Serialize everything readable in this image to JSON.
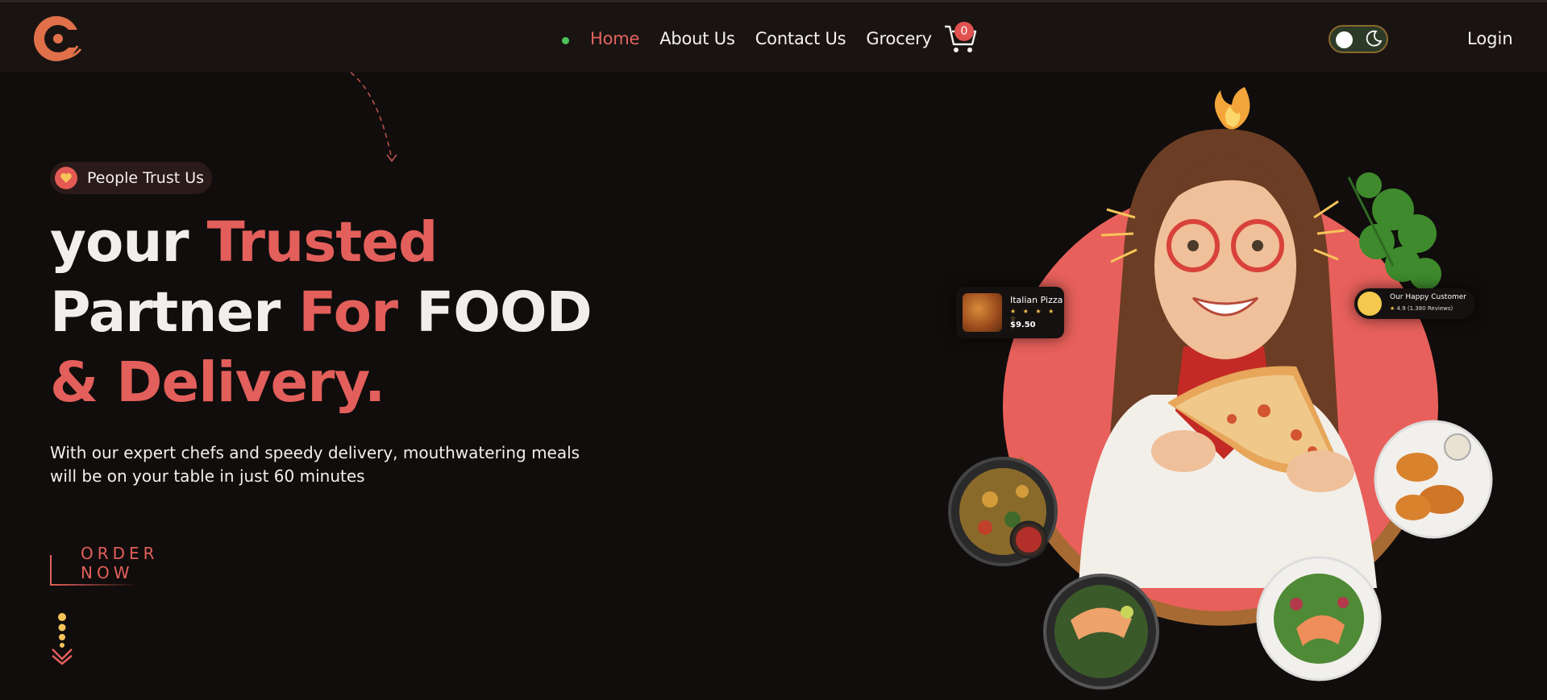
{
  "nav": {
    "items": [
      {
        "label": "Home",
        "active": true
      },
      {
        "label": "About Us",
        "active": false
      },
      {
        "label": "Contact Us",
        "active": false
      },
      {
        "label": "Grocery",
        "active": false
      }
    ],
    "cart_count": "0",
    "login_label": "Login",
    "theme_toggle": {
      "icons": [
        "sun-icon",
        "moon-icon"
      ],
      "mode": "dark"
    }
  },
  "hero": {
    "badge_label": "People Trust Us",
    "headline": {
      "line1_a": "your ",
      "line1_b": "Trusted",
      "line2_a": "Partner ",
      "line2_b": "For",
      "line2_c": " FOOD",
      "line3": "& Delivery."
    },
    "lead_text": "With our expert chefs and speedy delivery, mouthwatering meals will be on your table in just 60 minutes",
    "cta_label": "ORDER NOW"
  },
  "cards": {
    "pizza": {
      "name": "Italian Pizza",
      "stars": "★ ★ ★ ★ ☆",
      "rating": 4,
      "price": "$9.50"
    },
    "customer": {
      "title": "Our Happy Customer",
      "score": "4.9",
      "reviews": "(1.380 Reviews)"
    }
  },
  "colors": {
    "background": "#100d0c",
    "nav_background": "#191412",
    "accent": "#e35f5b",
    "active_dot": "#4dc35a",
    "gold": "#f0c44a"
  }
}
